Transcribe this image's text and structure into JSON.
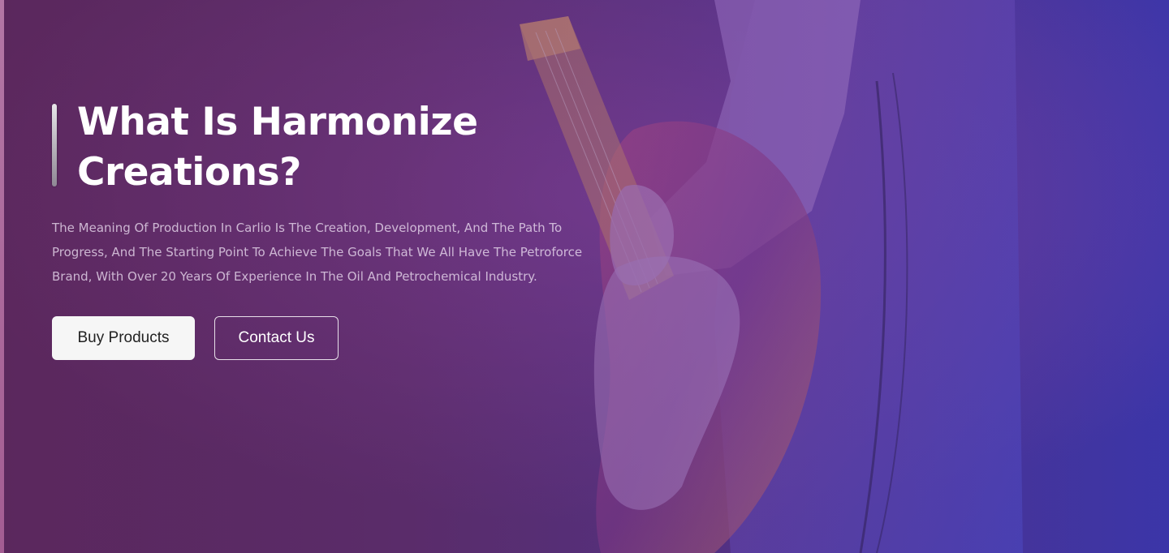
{
  "hero": {
    "title": "What Is Harmonize Creations?",
    "description": "The Meaning Of Production In Carlio Is The Creation, Development, And The Path To Progress, And The Starting Point To Achieve The Goals That We All Have The Petroforce Brand, With Over 20 Years Of Experience In The Oil And Petrochemical Industry.",
    "buttons": {
      "primary_label": "Buy Products",
      "secondary_label": "Contact Us"
    },
    "background_image": "guitarist-playing-electric-guitar"
  },
  "colors": {
    "gradient_left": "#5a2a5e",
    "gradient_right": "#3b36a8",
    "primary_button_bg": "#f6f6f6",
    "primary_button_text": "#222222",
    "text": "#ffffff"
  }
}
